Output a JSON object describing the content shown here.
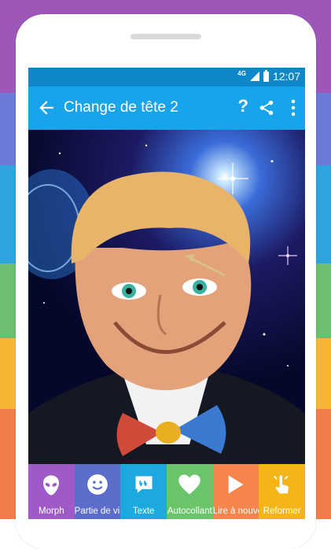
{
  "status_bar": {
    "network": "4G",
    "time": "12:07"
  },
  "app_bar": {
    "title": "Change de tête 2"
  },
  "tabs": [
    {
      "label": "Morph",
      "icon": "alien-icon",
      "color": "#a05ac8"
    },
    {
      "label": "Partie de visage",
      "icon": "smiley-icon",
      "color": "#5b6cc9"
    },
    {
      "label": "Texte",
      "icon": "speech-bubble-icon",
      "color": "#1ea8e0"
    },
    {
      "label": "Autocollant",
      "icon": "heart-icon",
      "color": "#6ac46a"
    },
    {
      "label": "Lire à nouveau",
      "icon": "play-icon",
      "color": "#f5854c"
    },
    {
      "label": "Reformer",
      "icon": "finger-touch-icon",
      "color": "#f5b418"
    }
  ],
  "colors": {
    "status_bar": "#0f87c8",
    "app_bar": "#18a4ea"
  }
}
